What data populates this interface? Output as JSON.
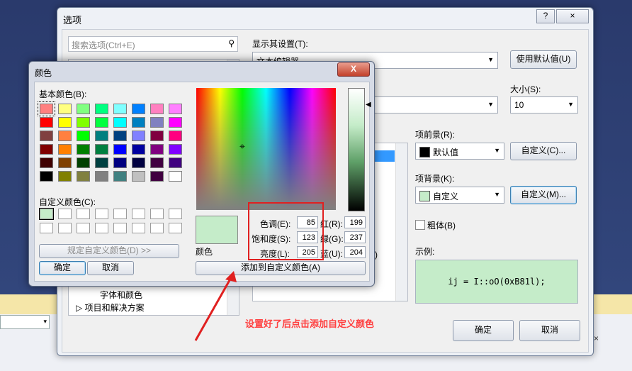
{
  "background": {
    "combo_arrow": "▾",
    "close_glyph": "×"
  },
  "options": {
    "title": "选项",
    "help_btn": "?",
    "close_btn": "×",
    "search_placeholder": "搜索选项(Ctrl+E)",
    "tree_items": [
      "字体和颜色",
      "项目和解决方案"
    ],
    "show_settings_label": "显示其设置(T):",
    "show_settings_value": "文本编辑器",
    "use_default_btn": "使用默认值(U)",
    "size_label": "大小(S):",
    "size_value": "10",
    "fg_label": "项前景(R):",
    "fg_value": "默认值",
    "fg_custom_btn": "自定义(C)...",
    "bg_label": "项背景(K):",
    "bg_value": "自定义",
    "bg_custom_btn": "自定义(M)...",
    "bold_label": "粗体(B)",
    "sample_label": "示例:",
    "sample_text": "ij = I::oO(0xB81l);",
    "ok_btn": "确定",
    "cancel_btn": "取消",
    "fg_swatch_color": "#000000",
    "bg_swatch_color": "#c5ecc9",
    "list_partial_text": "色)"
  },
  "color_dialog": {
    "title": "颜色",
    "close_btn": "X",
    "basic_label": "基本颜色(B):",
    "custom_label": "自定义颜色(C):",
    "define_custom_btn": "规定自定义颜色(D) >>",
    "ok_btn": "确定",
    "cancel_btn": "取消",
    "color_label": "颜色",
    "add_custom_btn": "添加到自定义颜色(A)",
    "hue_label": "色调(E):",
    "sat_label": "饱和度(S):",
    "lum_label": "亮度(L):",
    "red_label": "红(R):",
    "green_label": "绿(G):",
    "blue_label": "蓝(U):",
    "hue": "85",
    "sat": "123",
    "lum": "205",
    "red": "199",
    "green": "237",
    "blue": "204",
    "selected_color": "#c5ecc9",
    "basic_colors": [
      [
        "#ff8080",
        "#ffff80",
        "#80ff80",
        "#00ff80",
        "#80ffff",
        "#0080ff",
        "#ff80c0",
        "#ff80ff"
      ],
      [
        "#ff0000",
        "#ffff00",
        "#80ff00",
        "#00ff40",
        "#00ffff",
        "#0080c0",
        "#8080c0",
        "#ff00ff"
      ],
      [
        "#804040",
        "#ff8040",
        "#00ff00",
        "#008080",
        "#004080",
        "#8080ff",
        "#800040",
        "#ff0080"
      ],
      [
        "#800000",
        "#ff8000",
        "#008000",
        "#008040",
        "#0000ff",
        "#0000a0",
        "#800080",
        "#8000ff"
      ],
      [
        "#400000",
        "#804000",
        "#004000",
        "#004040",
        "#000080",
        "#000040",
        "#400040",
        "#400080"
      ],
      [
        "#000000",
        "#808000",
        "#808040",
        "#808080",
        "#408080",
        "#c0c0c0",
        "#400040",
        "#ffffff"
      ]
    ]
  },
  "annotation": "设置好了后点击添加自定义颜色"
}
